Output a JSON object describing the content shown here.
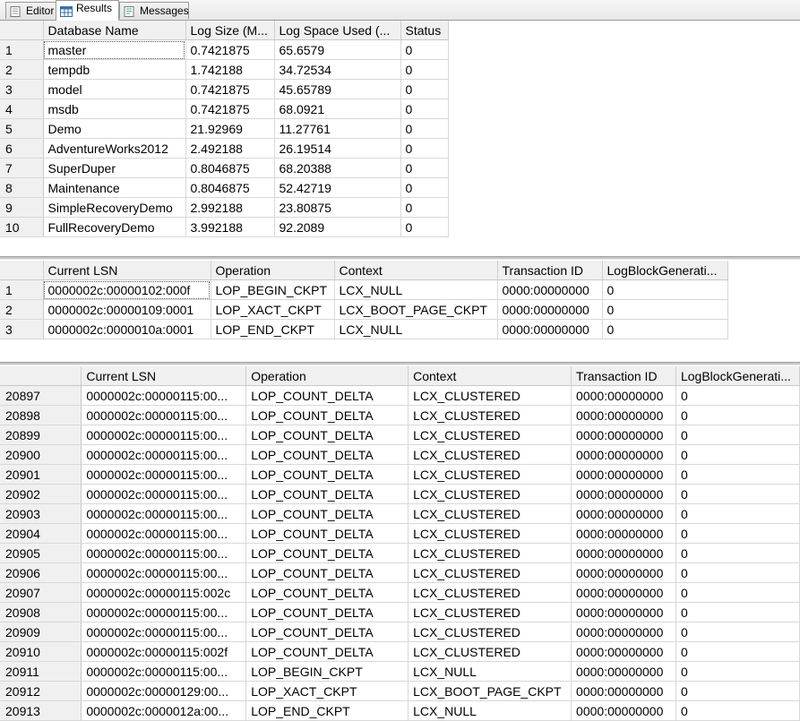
{
  "tabs": [
    {
      "label": "Editor",
      "icon": "editor-icon"
    },
    {
      "label": "Results",
      "icon": "results-grid-icon"
    },
    {
      "label": "Messages",
      "icon": "messages-icon"
    }
  ],
  "grid1": {
    "columns": [
      "Database Name",
      "Log Size (M...",
      "Log Space Used (...",
      "Status"
    ],
    "rows": [
      {
        "n": "1",
        "c": [
          "master",
          "0.7421875",
          "65.6579",
          "0"
        ]
      },
      {
        "n": "2",
        "c": [
          "tempdb",
          "1.742188",
          "34.72534",
          "0"
        ]
      },
      {
        "n": "3",
        "c": [
          "model",
          "0.7421875",
          "45.65789",
          "0"
        ]
      },
      {
        "n": "4",
        "c": [
          "msdb",
          "0.7421875",
          "68.0921",
          "0"
        ]
      },
      {
        "n": "5",
        "c": [
          "Demo",
          "21.92969",
          "11.27761",
          "0"
        ]
      },
      {
        "n": "6",
        "c": [
          "AdventureWorks2012",
          "2.492188",
          "26.19514",
          "0"
        ]
      },
      {
        "n": "7",
        "c": [
          "SuperDuper",
          "0.8046875",
          "68.20388",
          "0"
        ]
      },
      {
        "n": "8",
        "c": [
          "Maintenance",
          "0.8046875",
          "52.42719",
          "0"
        ]
      },
      {
        "n": "9",
        "c": [
          "SimpleRecoveryDemo",
          "2.992188",
          "23.80875",
          "0"
        ]
      },
      {
        "n": "10",
        "c": [
          "FullRecoveryDemo",
          "3.992188",
          "92.2089",
          "0"
        ]
      }
    ]
  },
  "grid2": {
    "columns": [
      "Current LSN",
      "Operation",
      "Context",
      "Transaction ID",
      "LogBlockGenerati..."
    ],
    "rows": [
      {
        "n": "1",
        "c": [
          "0000002c:00000102:000f",
          "LOP_BEGIN_CKPT",
          "LCX_NULL",
          "0000:00000000",
          "0"
        ]
      },
      {
        "n": "2",
        "c": [
          "0000002c:00000109:0001",
          "LOP_XACT_CKPT",
          "LCX_BOOT_PAGE_CKPT",
          "0000:00000000",
          "0"
        ]
      },
      {
        "n": "3",
        "c": [
          "0000002c:0000010a:0001",
          "LOP_END_CKPT",
          "LCX_NULL",
          "0000:00000000",
          "0"
        ]
      }
    ]
  },
  "grid3": {
    "columns": [
      "Current LSN",
      "Operation",
      "Context",
      "Transaction ID",
      "LogBlockGenerati..."
    ],
    "rows": [
      {
        "n": "20897",
        "c": [
          "0000002c:00000115:00...",
          "LOP_COUNT_DELTA",
          "LCX_CLUSTERED",
          "0000:00000000",
          "0"
        ]
      },
      {
        "n": "20898",
        "c": [
          "0000002c:00000115:00...",
          "LOP_COUNT_DELTA",
          "LCX_CLUSTERED",
          "0000:00000000",
          "0"
        ]
      },
      {
        "n": "20899",
        "c": [
          "0000002c:00000115:00...",
          "LOP_COUNT_DELTA",
          "LCX_CLUSTERED",
          "0000:00000000",
          "0"
        ]
      },
      {
        "n": "20900",
        "c": [
          "0000002c:00000115:00...",
          "LOP_COUNT_DELTA",
          "LCX_CLUSTERED",
          "0000:00000000",
          "0"
        ]
      },
      {
        "n": "20901",
        "c": [
          "0000002c:00000115:00...",
          "LOP_COUNT_DELTA",
          "LCX_CLUSTERED",
          "0000:00000000",
          "0"
        ]
      },
      {
        "n": "20902",
        "c": [
          "0000002c:00000115:00...",
          "LOP_COUNT_DELTA",
          "LCX_CLUSTERED",
          "0000:00000000",
          "0"
        ]
      },
      {
        "n": "20903",
        "c": [
          "0000002c:00000115:00...",
          "LOP_COUNT_DELTA",
          "LCX_CLUSTERED",
          "0000:00000000",
          "0"
        ]
      },
      {
        "n": "20904",
        "c": [
          "0000002c:00000115:00...",
          "LOP_COUNT_DELTA",
          "LCX_CLUSTERED",
          "0000:00000000",
          "0"
        ]
      },
      {
        "n": "20905",
        "c": [
          "0000002c:00000115:00...",
          "LOP_COUNT_DELTA",
          "LCX_CLUSTERED",
          "0000:00000000",
          "0"
        ]
      },
      {
        "n": "20906",
        "c": [
          "0000002c:00000115:00...",
          "LOP_COUNT_DELTA",
          "LCX_CLUSTERED",
          "0000:00000000",
          "0"
        ]
      },
      {
        "n": "20907",
        "c": [
          "0000002c:00000115:002c",
          "LOP_COUNT_DELTA",
          "LCX_CLUSTERED",
          "0000:00000000",
          "0"
        ]
      },
      {
        "n": "20908",
        "c": [
          "0000002c:00000115:00...",
          "LOP_COUNT_DELTA",
          "LCX_CLUSTERED",
          "0000:00000000",
          "0"
        ]
      },
      {
        "n": "20909",
        "c": [
          "0000002c:00000115:00...",
          "LOP_COUNT_DELTA",
          "LCX_CLUSTERED",
          "0000:00000000",
          "0"
        ]
      },
      {
        "n": "20910",
        "c": [
          "0000002c:00000115:002f",
          "LOP_COUNT_DELTA",
          "LCX_CLUSTERED",
          "0000:00000000",
          "0"
        ]
      },
      {
        "n": "20911",
        "c": [
          "0000002c:00000115:00...",
          "LOP_BEGIN_CKPT",
          "LCX_NULL",
          "0000:00000000",
          "0"
        ]
      },
      {
        "n": "20912",
        "c": [
          "0000002c:00000129:00...",
          "LOP_XACT_CKPT",
          "LCX_BOOT_PAGE_CKPT",
          "0000:00000000",
          "0"
        ]
      },
      {
        "n": "20913",
        "c": [
          "0000002c:0000012a:00...",
          "LOP_END_CKPT",
          "LCX_NULL",
          "0000:00000000",
          "0"
        ]
      }
    ]
  }
}
